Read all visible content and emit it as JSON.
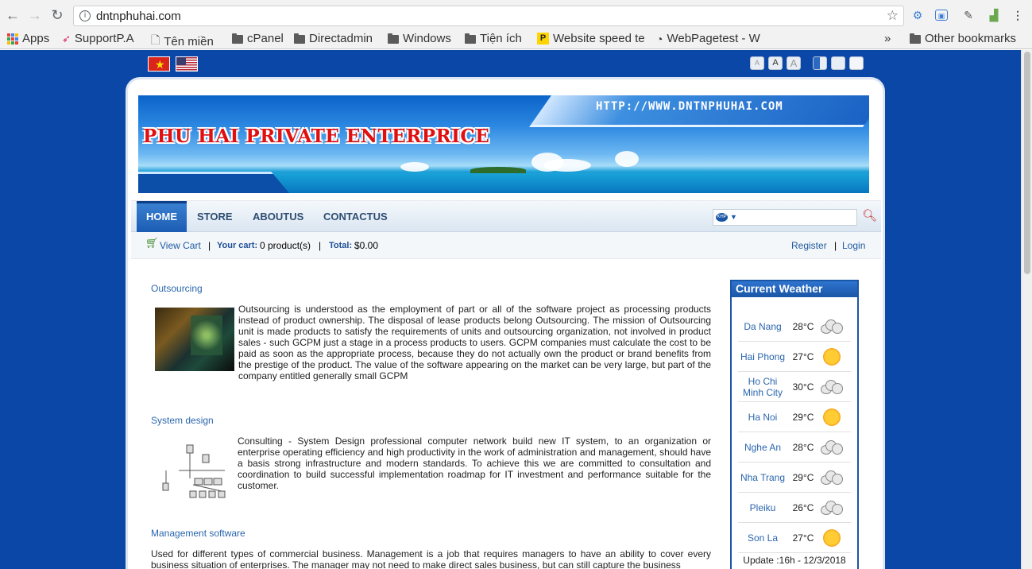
{
  "browser": {
    "url": "dntnphuhai.com",
    "bookmarks": [
      "Apps",
      "SupportP.A",
      "Tên miền",
      "cPanel",
      "Directadmin",
      "Windows",
      "Tiện ích",
      "Website speed te",
      "WebPagetest - W"
    ],
    "other_bookmarks": "Other bookmarks",
    "overflow": "»"
  },
  "site": {
    "banner_url": "HTTP://WWW.DNTNPHUHAI.COM",
    "banner_title": "PHU HAI PRIVATE ENTERPRICE",
    "font_size_buttons": [
      "A",
      "A",
      "A"
    ],
    "menu": [
      "HOME",
      "STORE",
      "ABOUTUS",
      "CONTACTUS"
    ],
    "search_logo": "KHP",
    "cart": {
      "view_cart": "View Cart",
      "sep": "|",
      "your_cart_label": "Your cart:",
      "your_cart_value": "0 product(s)",
      "total_label": "Total:",
      "total_value": "$0.00",
      "register": "Register",
      "login": "Login"
    },
    "sections": [
      {
        "title": "Outsourcing",
        "text": "Outsourcing is understood as the employment of part or all of the software project as processing products instead of product ownership. The disposal of lease products belong Outsourcing. The mission of Outsourcing unit is made products to satisfy the requirements of units and outsourcing organization, not involved in product sales - such GCPM just a stage in a process products to users. GCPM companies must calculate the cost to be paid as soon as the appropriate process, because they do not actually own the product or brand benefits from the prestige of the product. The value of the software appearing on the market can be very large, but part of the company entitled generally small GCPM"
      },
      {
        "title": "System design",
        "text": "Consulting - System Design professional computer network build new IT system, to an organization or enterprise operating efficiency and high productivity in the work of administration and management, should have a basis strong infrastructure and modern standards. To achieve this we are committed to consultation and coordination to build successful implementation roadmap for IT investment and performance suitable for the customer."
      },
      {
        "title": "Management software",
        "text": "Used for different types of commercial business. Management is a job that requires managers to have an ability to cover every business situation of enterprises. The manager may not need to make direct sales business, but can still capture the business"
      }
    ],
    "weather": {
      "title": "Current Weather",
      "rows": [
        {
          "city": "Da Nang",
          "temp": "28°C",
          "icon": "cloudy-icon"
        },
        {
          "city": "Hai Phong",
          "temp": "27°C",
          "icon": "sunny-icon"
        },
        {
          "city": "Ho Chi Minh City",
          "temp": "30°C",
          "icon": "cloudy-icon"
        },
        {
          "city": "Ha Noi",
          "temp": "29°C",
          "icon": "sunny-icon"
        },
        {
          "city": "Nghe An",
          "temp": "28°C",
          "icon": "cloudy-icon"
        },
        {
          "city": "Nha Trang",
          "temp": "29°C",
          "icon": "cloudy-icon"
        },
        {
          "city": "Pleiku",
          "temp": "26°C",
          "icon": "cloudy-icon"
        },
        {
          "city": "Son La",
          "temp": "27°C",
          "icon": "sunny-icon"
        }
      ],
      "update": "Update :16h - 12/3/2018"
    }
  },
  "colors": {
    "page_bg": "#0a47a7",
    "link": "#2b66ae",
    "banner_title": "#e01010",
    "menu_active": "#1a5cb2"
  }
}
